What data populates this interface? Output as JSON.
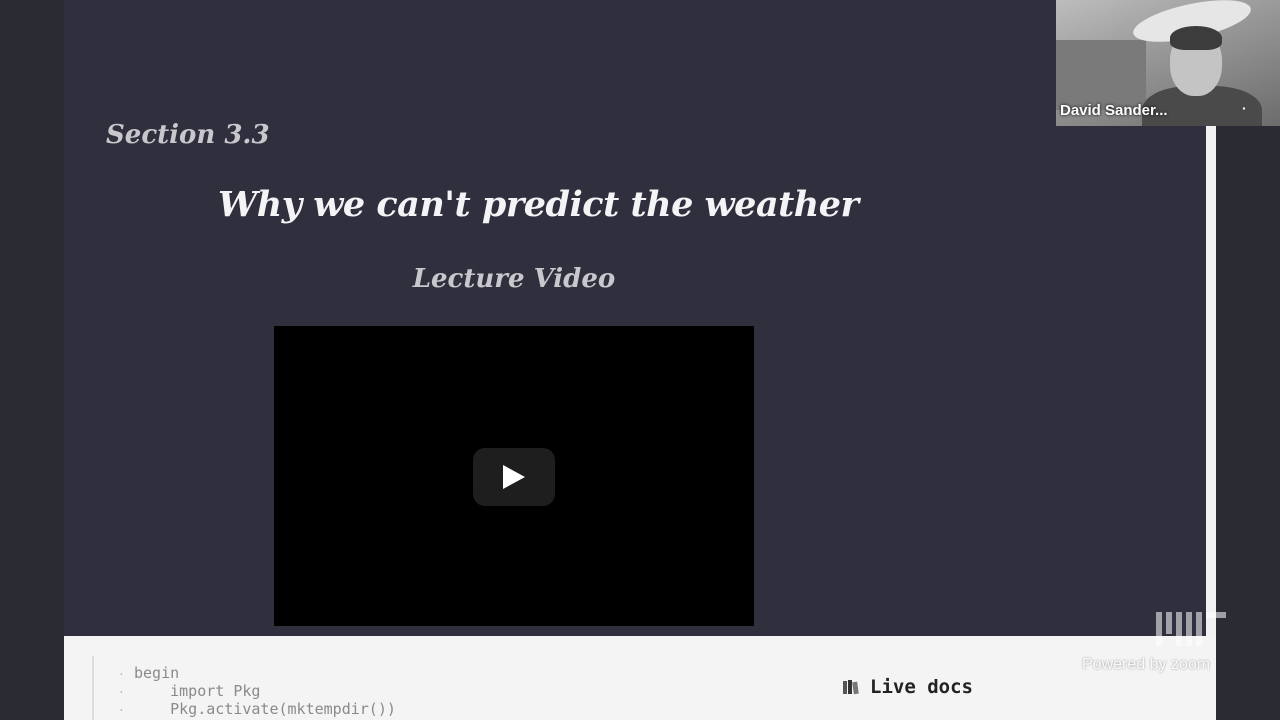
{
  "slide": {
    "section": "Section 3.3",
    "title": "Why we can't predict the weather",
    "subtitle": "Lecture Video"
  },
  "video": {
    "play_icon": "play-icon"
  },
  "code": {
    "lines": [
      "begin",
      "    import Pkg",
      "    Pkg.activate(mktempdir())"
    ]
  },
  "live_docs": {
    "icon": "books-icon",
    "label": "Live docs"
  },
  "participant": {
    "name": "David Sander...",
    "more": "·"
  },
  "watermark": {
    "logo": "MIT",
    "powered_by": "Powered by zoom"
  },
  "colors": {
    "slide_bg": "#2f2f3e",
    "video_bg": "#000000",
    "code_panel_bg": "#f4f4f4"
  }
}
